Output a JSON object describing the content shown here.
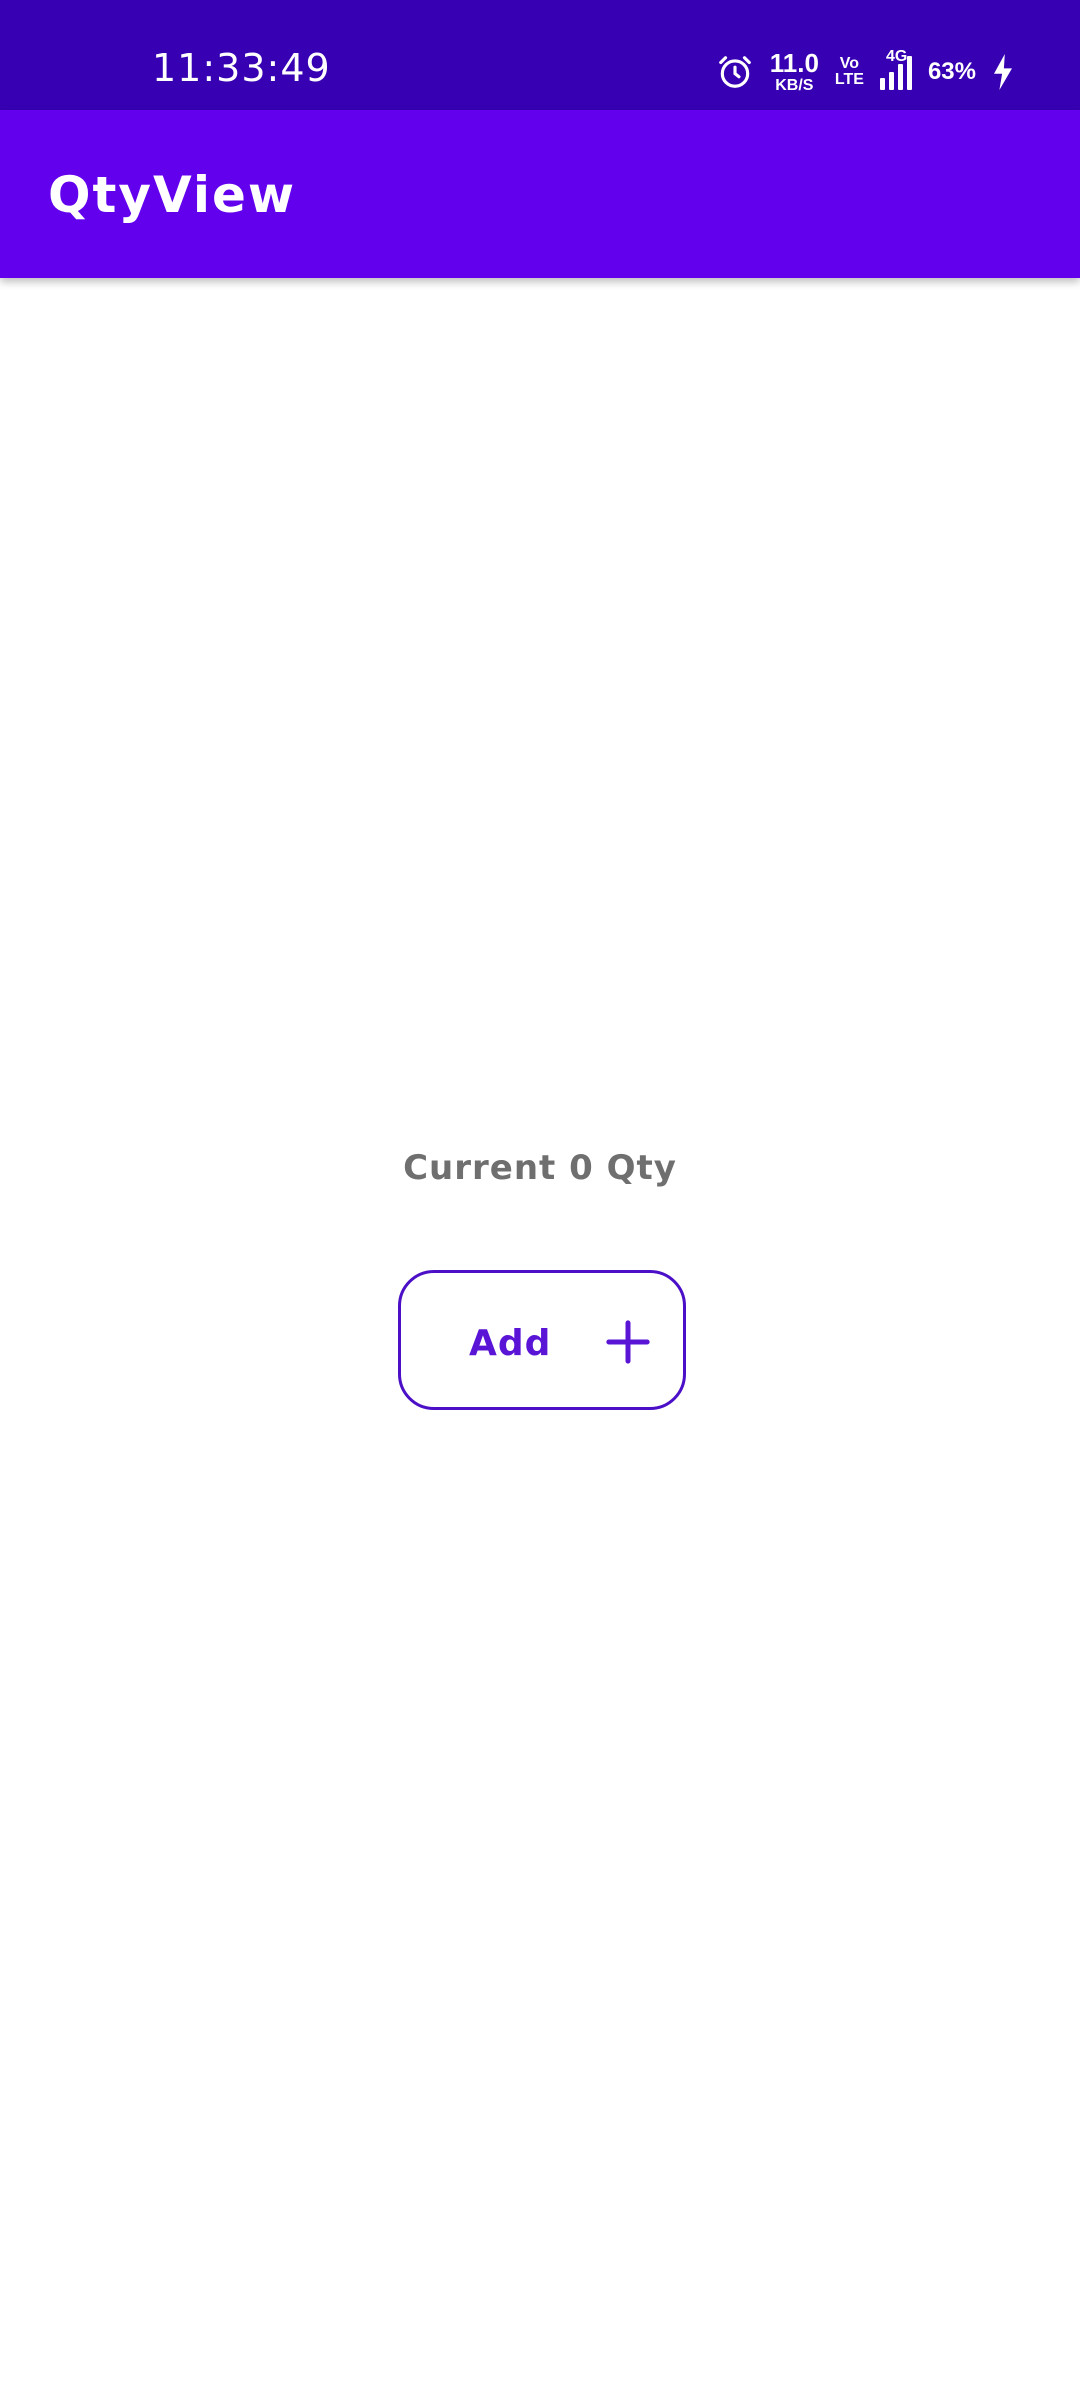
{
  "status_bar": {
    "time": "11:33:49",
    "net_speed_value": "11.0",
    "net_speed_unit": "KB/S",
    "volte_top": "Vo",
    "volte_bottom": "LTE",
    "network": "4G",
    "battery": "63%",
    "icons": [
      "alarm-icon",
      "signal-icon",
      "charging-bolt-icon"
    ]
  },
  "app_bar": {
    "title": "QtyView"
  },
  "main": {
    "qty_text": "Current 0 Qty",
    "add_button_label": "Add",
    "add_button_icon": "plus-icon"
  },
  "colors": {
    "status_bar": "#3700b3",
    "app_bar": "#6200ee",
    "accent": "#5a14d6",
    "label_gray": "#6f6f6f"
  }
}
